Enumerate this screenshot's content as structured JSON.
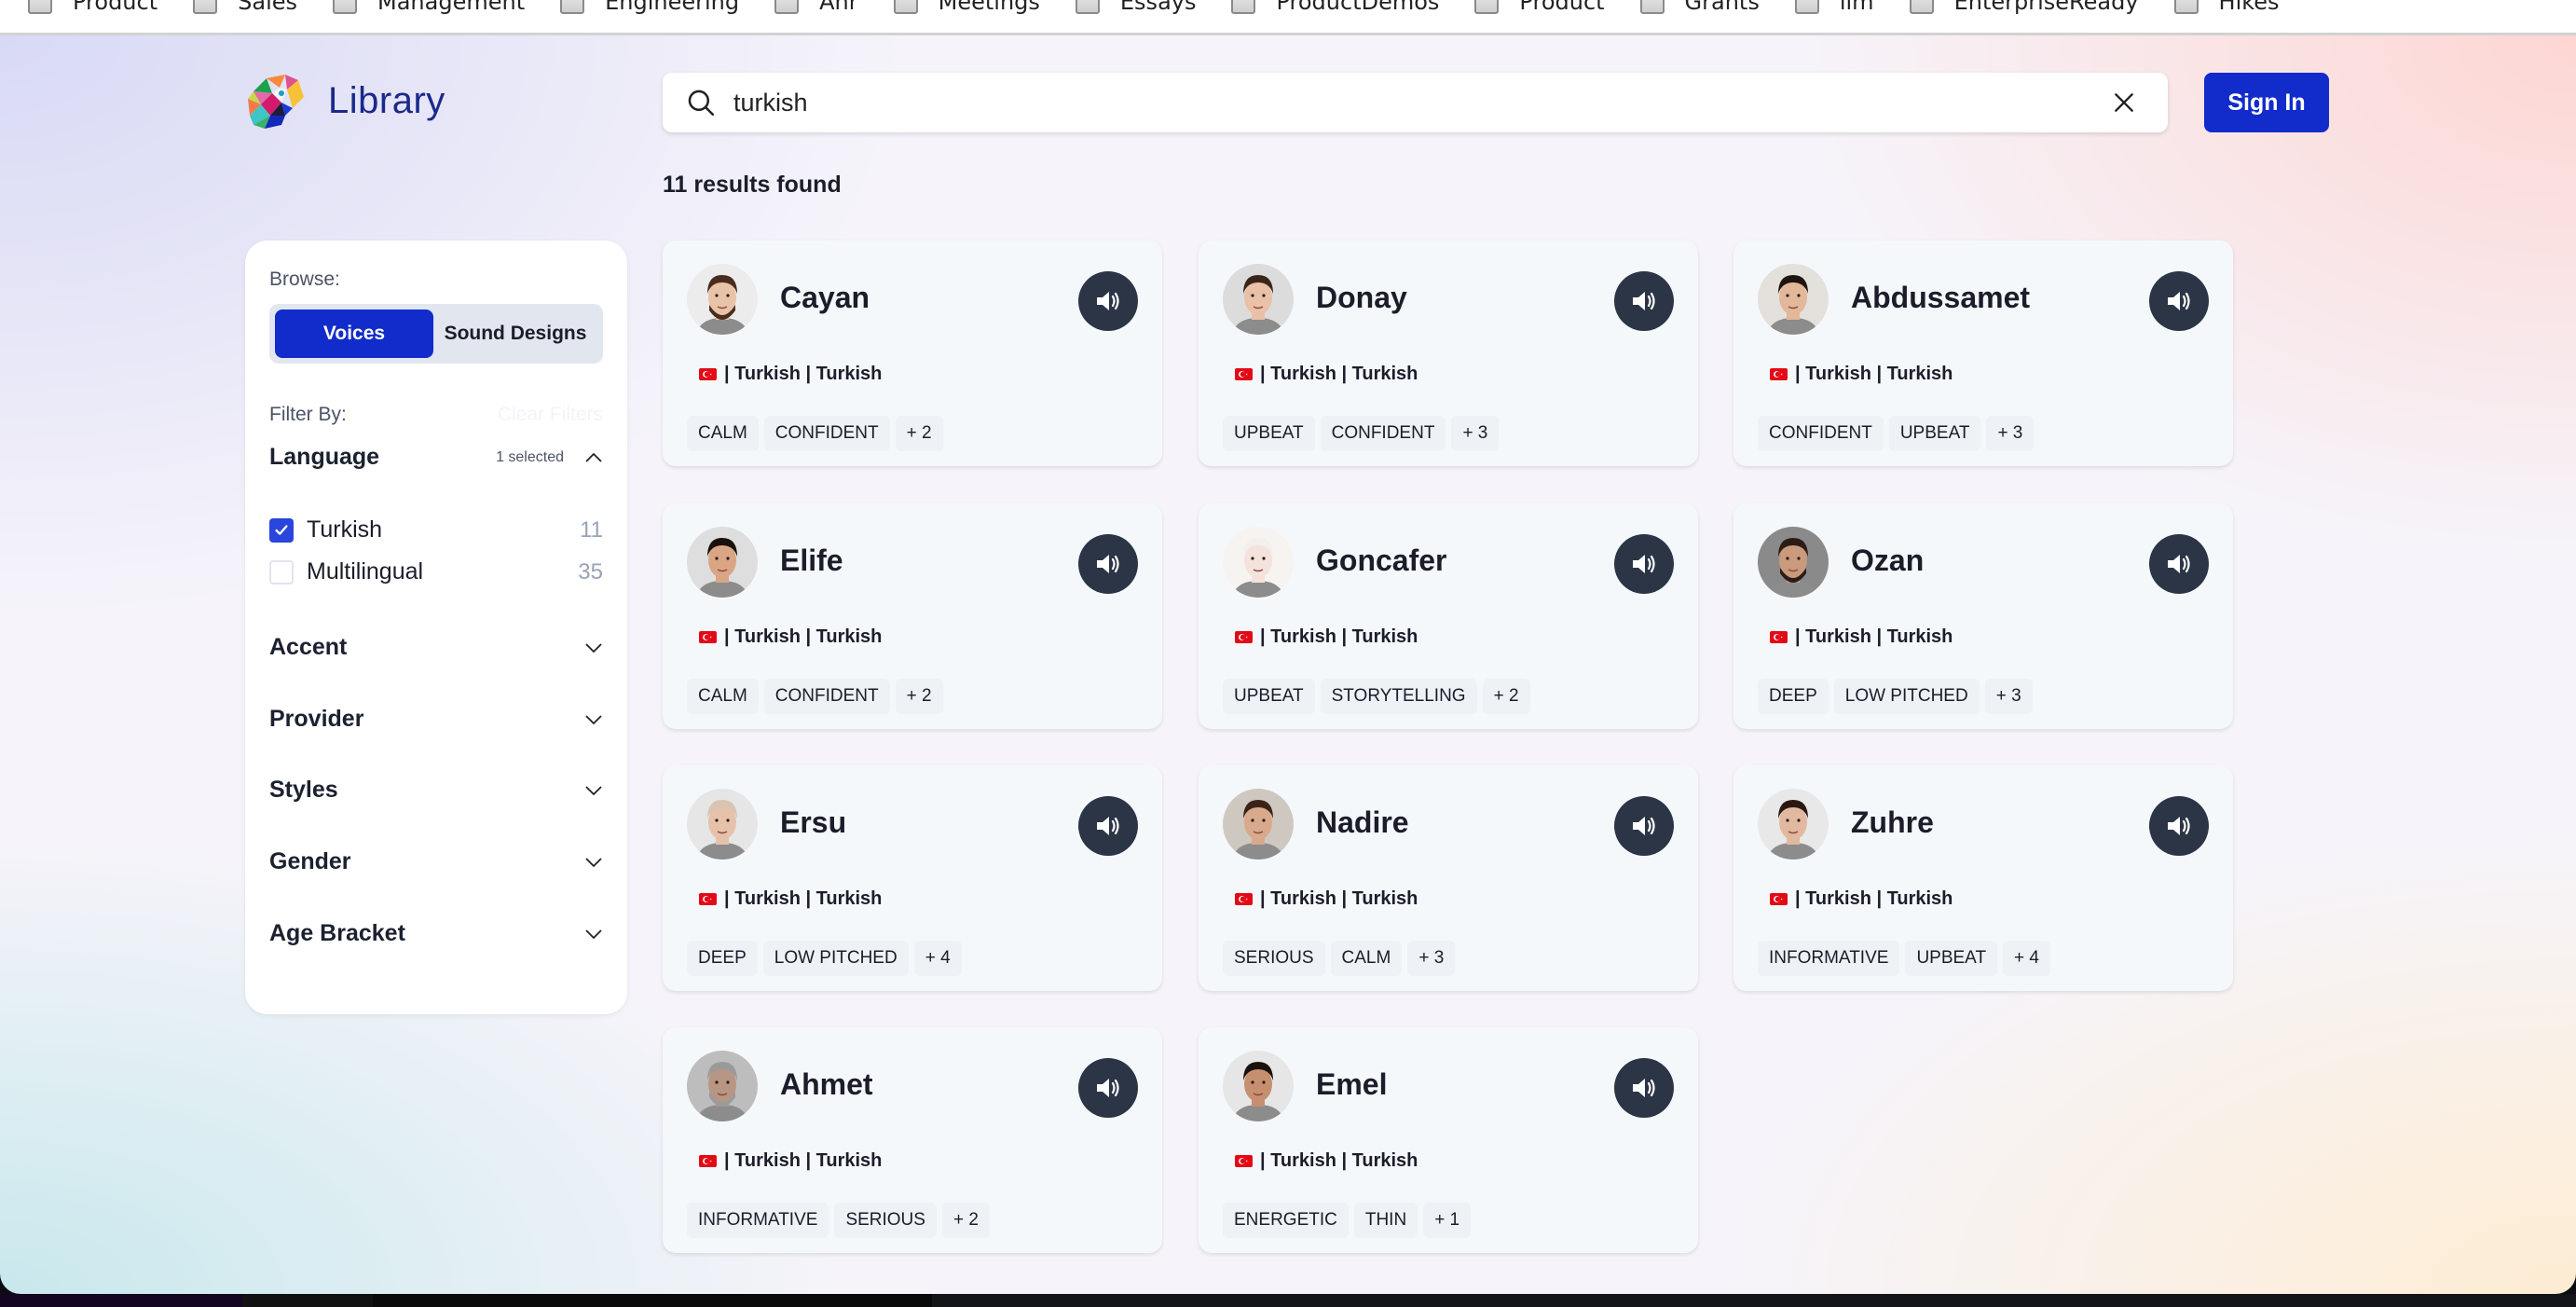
{
  "bookmarks": [
    "Product",
    "Sales",
    "Management",
    "Engineering",
    "Ahr",
    "Meetings",
    "Essays",
    "ProductDemos",
    "Product",
    "Grants",
    "llm",
    "EnterpriseReady",
    "Hikes"
  ],
  "header": {
    "logo_icon": "parrot-logo-icon",
    "title": "Library",
    "search": {
      "value": "turkish",
      "icon": "search-icon",
      "clear_icon": "close-icon"
    },
    "sign_in_label": "Sign In"
  },
  "results_text": "11 results found",
  "sidebar": {
    "browse_label": "Browse:",
    "browse_options": [
      {
        "label": "Voices",
        "active": true
      },
      {
        "label": "Sound Designs",
        "active": false
      }
    ],
    "filter_label": "Filter By:",
    "clear_filters_label": "Clear Filters",
    "language": {
      "title": "Language",
      "selected_text": "1 selected",
      "expanded": true,
      "options": [
        {
          "label": "Turkish",
          "count": "11",
          "checked": true
        },
        {
          "label": "Multilingual",
          "count": "35",
          "checked": false
        }
      ]
    },
    "collapsed_facets": [
      "Accent",
      "Provider",
      "Styles",
      "Gender",
      "Age Bracket"
    ]
  },
  "voices": [
    {
      "name": "Cayan",
      "flag": "turkey-flag-icon",
      "language_line": " | Turkish | Turkish",
      "tags": [
        "CALM",
        "CONFIDENT",
        "+ 2"
      ],
      "avatar": {
        "skin": "#e9c3a8",
        "hair": "#4a2c1c",
        "beard": true,
        "bg": "#ececec"
      }
    },
    {
      "name": "Donay",
      "flag": "turkey-flag-icon",
      "language_line": " | Turkish | Turkish",
      "tags": [
        "UPBEAT",
        "CONFIDENT",
        "+ 3"
      ],
      "avatar": {
        "skin": "#e8c1a6",
        "hair": "#3a2518",
        "beard": false,
        "bg": "#dcdcdc"
      }
    },
    {
      "name": "Abdussamet",
      "flag": "turkey-flag-icon",
      "language_line": " | Turkish | Turkish",
      "tags": [
        "CONFIDENT",
        "UPBEAT",
        "+ 3"
      ],
      "avatar": {
        "skin": "#e2b79a",
        "hair": "#1f1410",
        "beard": false,
        "bg": "#e4e0dc"
      }
    },
    {
      "name": "Elife",
      "flag": "turkey-flag-icon",
      "language_line": " | Turkish | Turkish",
      "tags": [
        "CALM",
        "CONFIDENT",
        "+ 2"
      ],
      "avatar": {
        "skin": "#d9a584",
        "hair": "#1a100b",
        "beard": false,
        "bg": "#dedede"
      }
    },
    {
      "name": "Goncafer",
      "flag": "turkey-flag-icon",
      "language_line": " | Turkish | Turkish",
      "tags": [
        "UPBEAT",
        "STORYTELLING",
        "+ 2"
      ],
      "avatar": {
        "skin": "#f3e3dc",
        "hair": "#f2efec",
        "beard": false,
        "bg": "#f6f3f1"
      }
    },
    {
      "name": "Ozan",
      "flag": "turkey-flag-icon",
      "language_line": " | Turkish | Turkish",
      "tags": [
        "DEEP",
        "LOW PITCHED",
        "+ 3"
      ],
      "avatar": {
        "skin": "#c99a7c",
        "hair": "#2b1d15",
        "beard": true,
        "bg": "#8a8a8a"
      }
    },
    {
      "name": "Ersu",
      "flag": "turkey-flag-icon",
      "language_line": " | Turkish | Turkish",
      "tags": [
        "DEEP",
        "LOW PITCHED",
        "+ 4"
      ],
      "avatar": {
        "skin": "#e6c2ab",
        "hair": "#d9c4b3",
        "beard": false,
        "bg": "#e6e6e6"
      }
    },
    {
      "name": "Nadire",
      "flag": "turkey-flag-icon",
      "language_line": " | Turkish | Turkish",
      "tags": [
        "SERIOUS",
        "CALM",
        "+ 3"
      ],
      "avatar": {
        "skin": "#d9a98b",
        "hair": "#3a2417",
        "beard": false,
        "bg": "#cfc8c0"
      }
    },
    {
      "name": "Zuhre",
      "flag": "turkey-flag-icon",
      "language_line": " | Turkish | Turkish",
      "tags": [
        "INFORMATIVE",
        "UPBEAT",
        "+ 4"
      ],
      "avatar": {
        "skin": "#e3b8a0",
        "hair": "#2a1812",
        "beard": false,
        "bg": "#e8e8e8"
      }
    },
    {
      "name": "Ahmet",
      "flag": "turkey-flag-icon",
      "language_line": " | Turkish | Turkish",
      "tags": [
        "INFORMATIVE",
        "SERIOUS",
        "+ 2"
      ],
      "avatar": {
        "skin": "#b89684",
        "hair": "#9a9a9a",
        "beard": true,
        "bg": "#bdbdbd"
      }
    },
    {
      "name": "Emel",
      "flag": "turkey-flag-icon",
      "language_line": " | Turkish | Turkish",
      "tags": [
        "ENERGETIC",
        "THIN",
        "+ 1"
      ],
      "avatar": {
        "skin": "#c58f70",
        "hair": "#1b120d",
        "beard": false,
        "bg": "#e6e6e6"
      }
    }
  ],
  "colors": {
    "accent": "#112ccb",
    "checkbox": "#2a45dc",
    "play_button": "#2c3546",
    "card_bg": "#f5f8fb",
    "tag_bg": "#eef1f5"
  }
}
